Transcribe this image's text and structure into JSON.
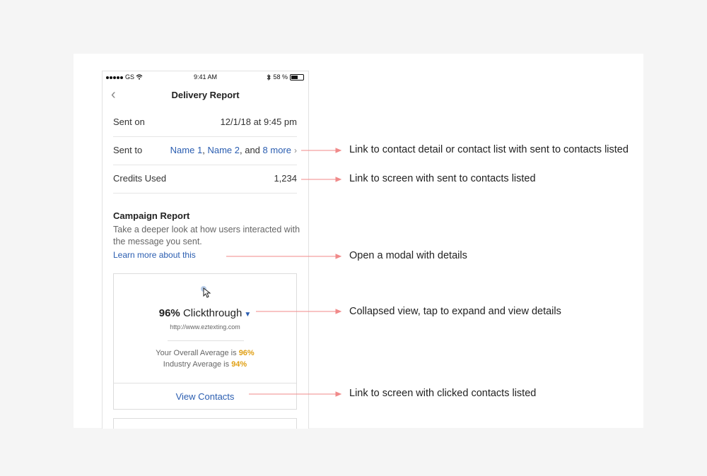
{
  "status_bar": {
    "carrier": "GS",
    "time": "9:41 AM",
    "battery": "58 %"
  },
  "nav": {
    "title": "Delivery Report"
  },
  "rows": {
    "sent_on": {
      "label": "Sent on",
      "value": "12/1/18 at 9:45 pm"
    },
    "sent_to": {
      "label": "Sent to",
      "name1": "Name 1",
      "sep1": ",",
      "name2": "Name 2",
      "sep2": ", and",
      "more": "8 more"
    },
    "credits": {
      "label": "Credits Used",
      "value": "1,234"
    }
  },
  "campaign": {
    "title": "Campaign Report",
    "description": "Take a deeper look at how users interacted with the message you sent.",
    "learn_more": "Learn more about this",
    "card": {
      "percent": "96%",
      "metric": "Clickthrough",
      "url": "http://www.eztexting.com",
      "overall_label": "Your Overall Average is",
      "overall_value": "96%",
      "industry_label": "Industry Average is",
      "industry_value": "94%",
      "view_contacts": "View Contacts"
    }
  },
  "annotations": [
    "Link to contact detail or contact list with sent to contacts listed",
    "Link to screen with sent to contacts listed",
    "Open a modal with details",
    "Collapsed view, tap to expand and view details",
    "Link to screen with clicked contacts listed"
  ],
  "colors": {
    "link": "#2a5db0",
    "accent_gold": "#e0a015",
    "arrow": "#f08a8a",
    "background": "#f5f5f5"
  },
  "icons": {
    "back": "chevron-left-icon",
    "wifi": "wifi-icon",
    "bluetooth": "bluetooth-icon",
    "battery": "battery-icon",
    "caret": "chevron-down-icon",
    "cursor": "pointer-cursor-icon"
  }
}
